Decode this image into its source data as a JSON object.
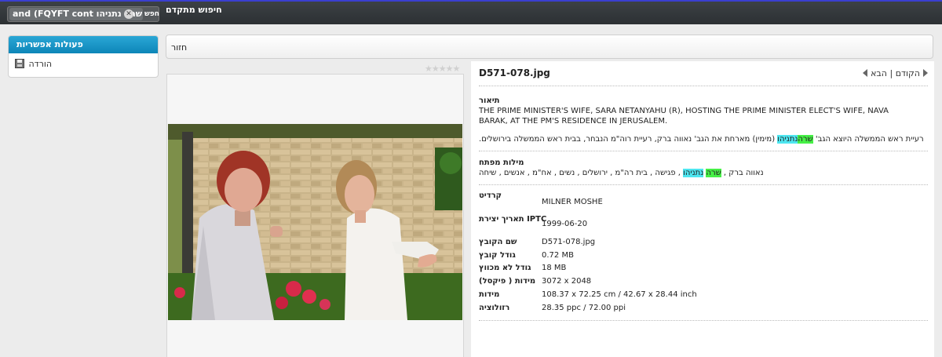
{
  "topbar": {
    "advanced_search_label": "חיפוש מתקדם",
    "search_tag_text": "and (FQYFT cont שרה נתניהו",
    "search_button_label": "חפש"
  },
  "sidebar": {
    "header": "פעולות אפשריות",
    "download_label": "הורדה"
  },
  "backbar": {
    "back_label": "חזור"
  },
  "rating": {
    "stars": 0,
    "max": 5
  },
  "detail": {
    "file_title": "D571-078.jpg",
    "nav": {
      "next_label": "הבא",
      "separator": "|",
      "prev_label": "הקודם"
    },
    "description_label": "תיאור",
    "description_en": "THE PRIME MINISTER'S WIFE, SARA NETANYAHU (R), HOSTING THE PRIME MINISTER ELECT'S WIFE, NAVA BARAK, AT THE PM'S RESIDENCE IN JERUSALEM.",
    "description_he_pre": ".רעיית ראש הממשלה היוצא הגב' ",
    "description_he_hl1": "שרה",
    "description_he_hl2": "נתניהו",
    "description_he_post": " (מימין) מארחת את הגב' נאווה ברק, רעיית רוה\"מ הנבחר, בבית ראש הממשלה בירושלים",
    "keywords_label": "מילות מפתח",
    "keywords_pre": "נאווה ברק , ",
    "keywords_hl1": "שרה",
    "keywords_hl2": "נתניהו",
    "keywords_post": " , פגישה , בית רה\"מ , ירושלים , נשים , אח\"מ , אנשים , שיחה",
    "credit_label": "קרדיט",
    "credit_value": "MILNER MOSHE",
    "iptc_label": "תאריך יצירת IPTC",
    "iptc_value": "1999-06-20",
    "rows": [
      {
        "label": "שם הקובץ",
        "value": "D571-078.jpg"
      },
      {
        "label": "גודל קובץ",
        "value": "0.72 MB"
      },
      {
        "label": "גודל לא מכווץ",
        "value": "18 MB"
      },
      {
        "label": "מידות ( פיקסל)",
        "value": "3072 x 2048"
      },
      {
        "label": "מידות",
        "value": "108.37 x 72.25 cm / 42.67 x 28.44 inch"
      },
      {
        "label": "רזולוציה",
        "value": "28.35 ppc / 72.00 ppi"
      }
    ]
  }
}
